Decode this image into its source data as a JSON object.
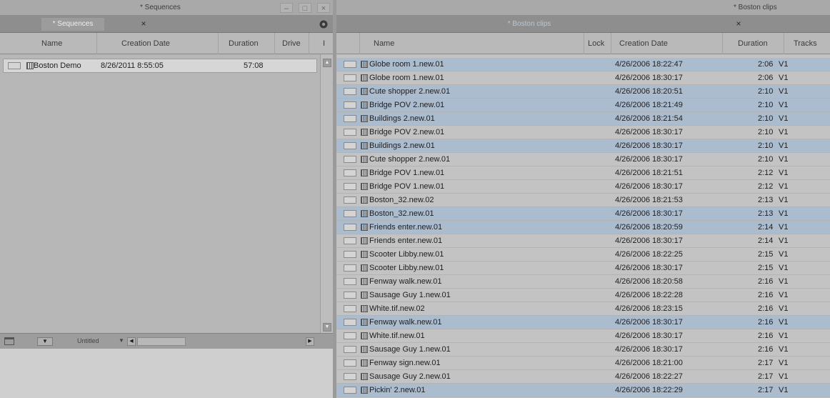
{
  "left_window": {
    "title": "* Sequences",
    "tab_label": "* Sequences",
    "tab_close": "×",
    "window_buttons": {
      "minimize": "–",
      "maximize": "□",
      "close": "×"
    },
    "settings_icon": "gear-icon",
    "columns": [
      "Name",
      "Creation Date",
      "Duration",
      "Drive",
      "I"
    ],
    "rows": [
      {
        "name": "Boston Demo",
        "creation_date": "8/26/2011 8:55:05",
        "duration": "57:08"
      }
    ],
    "bottom_bar": {
      "view_label": "Untitled"
    }
  },
  "right_window": {
    "title": "* Boston clips",
    "tab_label": "* Boston clips",
    "tab_close": "×",
    "columns": [
      "Name",
      "Lock",
      "Creation Date",
      "Duration",
      "Tracks"
    ],
    "rows": [
      {
        "name": "Globe room 1.new.01",
        "creation_date": "4/26/2006 18:22:47",
        "duration": "2:06",
        "tracks": "V1",
        "selected": true
      },
      {
        "name": "Globe room 1.new.01",
        "creation_date": "4/26/2006 18:30:17",
        "duration": "2:06",
        "tracks": "V1",
        "selected": false
      },
      {
        "name": "Cute shopper 2.new.01",
        "creation_date": "4/26/2006 18:20:51",
        "duration": "2:10",
        "tracks": "V1",
        "selected": true
      },
      {
        "name": "Bridge POV 2.new.01",
        "creation_date": "4/26/2006 18:21:49",
        "duration": "2:10",
        "tracks": "V1",
        "selected": true
      },
      {
        "name": "Buildings 2.new.01",
        "creation_date": "4/26/2006 18:21:54",
        "duration": "2:10",
        "tracks": "V1",
        "selected": true
      },
      {
        "name": "Bridge POV 2.new.01",
        "creation_date": "4/26/2006 18:30:17",
        "duration": "2:10",
        "tracks": "V1",
        "selected": false
      },
      {
        "name": "Buildings 2.new.01",
        "creation_date": "4/26/2006 18:30:17",
        "duration": "2:10",
        "tracks": "V1",
        "selected": true
      },
      {
        "name": "Cute shopper 2.new.01",
        "creation_date": "4/26/2006 18:30:17",
        "duration": "2:10",
        "tracks": "V1",
        "selected": false
      },
      {
        "name": "Bridge POV 1.new.01",
        "creation_date": "4/26/2006 18:21:51",
        "duration": "2:12",
        "tracks": "V1",
        "selected": false
      },
      {
        "name": "Bridge POV 1.new.01",
        "creation_date": "4/26/2006 18:30:17",
        "duration": "2:12",
        "tracks": "V1",
        "selected": false
      },
      {
        "name": "Boston_32.new.02",
        "creation_date": "4/26/2006 18:21:53",
        "duration": "2:13",
        "tracks": "V1",
        "selected": false
      },
      {
        "name": "Boston_32.new.01",
        "creation_date": "4/26/2006 18:30:17",
        "duration": "2:13",
        "tracks": "V1",
        "selected": true
      },
      {
        "name": "Friends enter.new.01",
        "creation_date": "4/26/2006 18:20:59",
        "duration": "2:14",
        "tracks": "V1",
        "selected": true
      },
      {
        "name": "Friends enter.new.01",
        "creation_date": "4/26/2006 18:30:17",
        "duration": "2:14",
        "tracks": "V1",
        "selected": false
      },
      {
        "name": "Scooter Libby.new.01",
        "creation_date": "4/26/2006 18:22:25",
        "duration": "2:15",
        "tracks": "V1",
        "selected": false
      },
      {
        "name": "Scooter Libby.new.01",
        "creation_date": "4/26/2006 18:30:17",
        "duration": "2:15",
        "tracks": "V1",
        "selected": false
      },
      {
        "name": "Fenway walk.new.01",
        "creation_date": "4/26/2006 18:20:58",
        "duration": "2:16",
        "tracks": "V1",
        "selected": false
      },
      {
        "name": "Sausage Guy 1.new.01",
        "creation_date": "4/26/2006 18:22:28",
        "duration": "2:16",
        "tracks": "V1",
        "selected": false
      },
      {
        "name": "White.tif.new.02",
        "creation_date": "4/26/2006 18:23:15",
        "duration": "2:16",
        "tracks": "V1",
        "selected": false
      },
      {
        "name": "Fenway walk.new.01",
        "creation_date": "4/26/2006 18:30:17",
        "duration": "2:16",
        "tracks": "V1",
        "selected": true
      },
      {
        "name": "White.tif.new.01",
        "creation_date": "4/26/2006 18:30:17",
        "duration": "2:16",
        "tracks": "V1",
        "selected": false
      },
      {
        "name": "Sausage Guy 1.new.01",
        "creation_date": "4/26/2006 18:30:17",
        "duration": "2:16",
        "tracks": "V1",
        "selected": false
      },
      {
        "name": "Fenway sign.new.01",
        "creation_date": "4/26/2006 18:21:00",
        "duration": "2:17",
        "tracks": "V1",
        "selected": false
      },
      {
        "name": "Sausage Guy 2.new.01",
        "creation_date": "4/26/2006 18:22:27",
        "duration": "2:17",
        "tracks": "V1",
        "selected": false
      },
      {
        "name": "Pickin' 2.new.01",
        "creation_date": "4/26/2006 18:22:29",
        "duration": "2:17",
        "tracks": "V1",
        "selected": true
      }
    ]
  },
  "colors": {
    "selected_row": "#acbccf",
    "unselected_row": "#c3c3c3",
    "panel_background": "#c6c6c6"
  }
}
